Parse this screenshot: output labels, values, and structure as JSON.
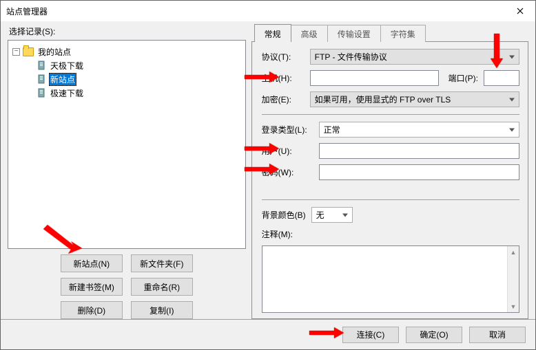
{
  "window": {
    "title": "站点管理器"
  },
  "left": {
    "select_label": "选择记录(S):",
    "root": "我的站点",
    "sites": [
      "天极下载",
      "新站点",
      "极速下载"
    ],
    "selected_index": 1,
    "buttons": {
      "new_site": "新站点(N)",
      "new_folder": "新文件夹(F)",
      "new_bookmark": "新建书签(M)",
      "rename": "重命名(R)",
      "delete": "删除(D)",
      "copy": "复制(I)"
    }
  },
  "tabs": [
    "常规",
    "高级",
    "传输设置",
    "字符集"
  ],
  "form": {
    "protocol_label": "协议(T):",
    "protocol_value": "FTP - 文件传输协议",
    "host_label": "主机(H):",
    "host_value": "",
    "port_label": "端口(P):",
    "port_value": "",
    "encryption_label": "加密(E):",
    "encryption_value": "如果可用，使用显式的 FTP over TLS",
    "logon_label": "登录类型(L):",
    "logon_value": "正常",
    "user_label": "用户(U):",
    "user_value": "",
    "password_label": "密码(W):",
    "password_value": "",
    "bgcolor_label": "背景颜色(B)",
    "bgcolor_value": "无",
    "notes_label": "注释(M):",
    "notes_value": ""
  },
  "bottom": {
    "connect": "连接(C)",
    "ok": "确定(O)",
    "cancel": "取消"
  }
}
